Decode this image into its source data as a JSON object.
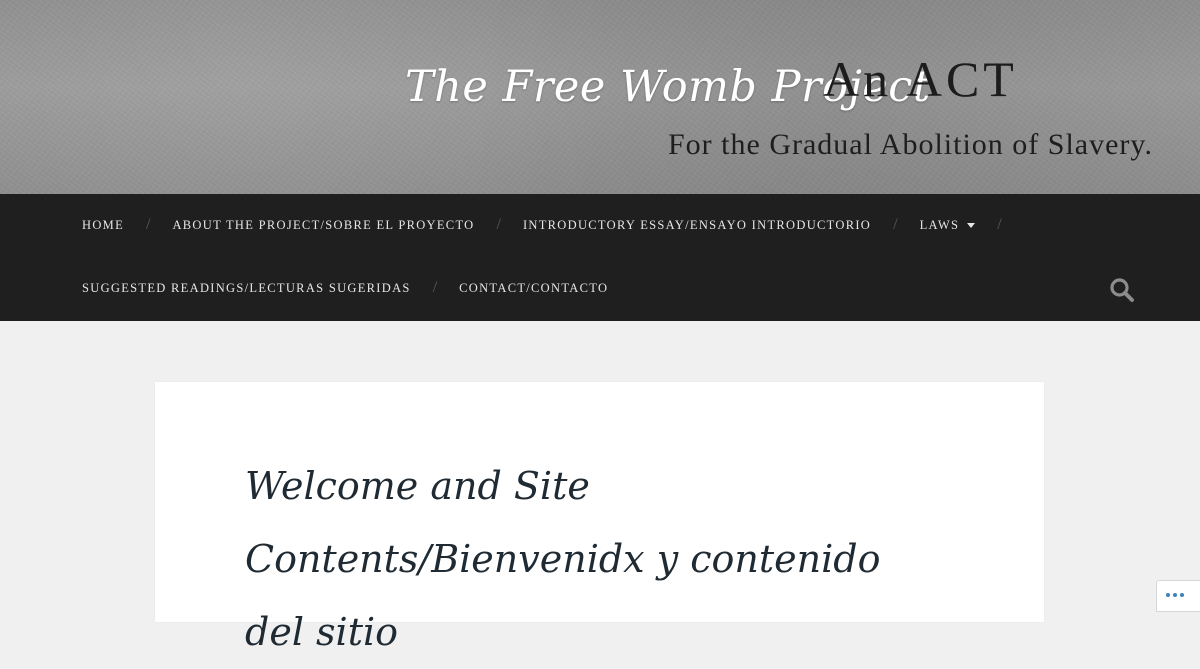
{
  "header": {
    "site_title": "The Free Womb Project",
    "banner_heading": "An ACT",
    "banner_subtitle": "For the Gradual Abolition of Slavery."
  },
  "nav": {
    "row1": [
      {
        "label": "HOME"
      },
      {
        "label": "ABOUT THE PROJECT/SOBRE EL PROYECTO"
      },
      {
        "label": "INTRODUCTORY ESSAY/ENSAYO INTRODUCTORIO"
      },
      {
        "label": "LAWS"
      }
    ],
    "row2": [
      {
        "label": "SUGGESTED READINGS/LECTURAS SUGERIDAS"
      },
      {
        "label": "CONTACT/CONTACTO"
      }
    ],
    "separator": "/",
    "search_icon": "search-icon"
  },
  "main": {
    "page_title": "Welcome and Site Contents/Bienvenidx y contenido del sitio"
  },
  "colors": {
    "nav_bg": "#1f1f1f",
    "page_bg": "#f0f0f0",
    "card_bg": "#ffffff",
    "title_color": "#1f2a33"
  }
}
